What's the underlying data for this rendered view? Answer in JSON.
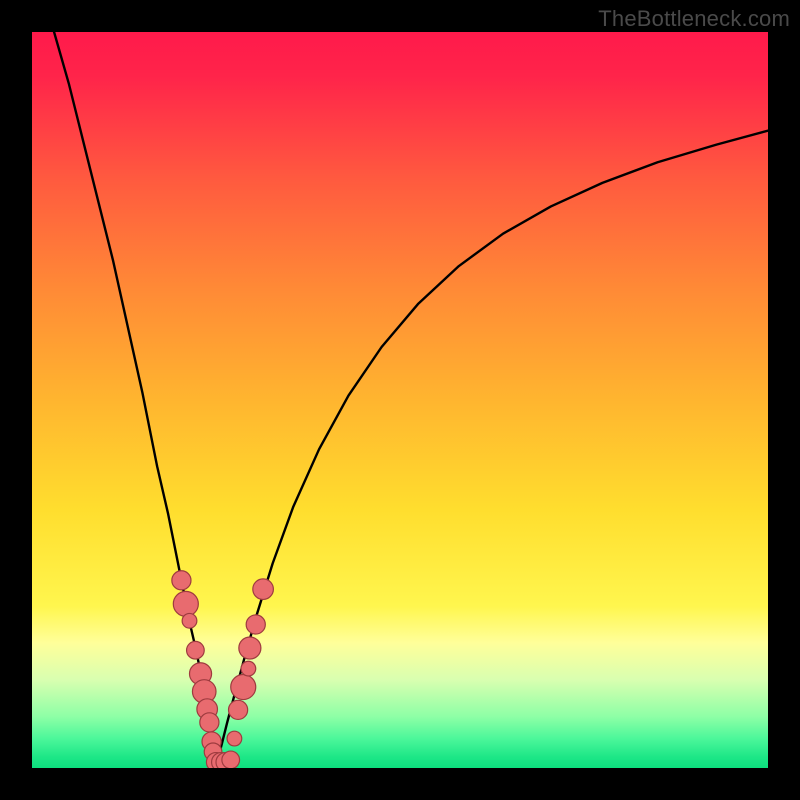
{
  "watermark": "TheBottleneck.com",
  "chart_data": {
    "type": "line",
    "title": "",
    "xlabel": "",
    "ylabel": "",
    "xlim": [
      0,
      100
    ],
    "ylim": [
      0,
      100
    ],
    "grid": false,
    "legend": false,
    "background_gradient": {
      "stops": [
        {
          "offset": 0.0,
          "color": "#ff1a4b"
        },
        {
          "offset": 0.06,
          "color": "#ff244a"
        },
        {
          "offset": 0.2,
          "color": "#ff5a3f"
        },
        {
          "offset": 0.35,
          "color": "#ff8a36"
        },
        {
          "offset": 0.5,
          "color": "#ffb52f"
        },
        {
          "offset": 0.65,
          "color": "#ffde2e"
        },
        {
          "offset": 0.78,
          "color": "#fff64e"
        },
        {
          "offset": 0.83,
          "color": "#ffff9a"
        },
        {
          "offset": 0.88,
          "color": "#d9ffb0"
        },
        {
          "offset": 0.93,
          "color": "#8effa6"
        },
        {
          "offset": 0.96,
          "color": "#4cf79a"
        },
        {
          "offset": 0.985,
          "color": "#1de787"
        },
        {
          "offset": 1.0,
          "color": "#0ddf7e"
        }
      ]
    },
    "series": [
      {
        "name": "left-curve",
        "type": "line",
        "color": "#000000",
        "x": [
          3,
          5,
          7,
          9,
          11,
          13,
          15,
          17,
          18.5,
          19.8,
          20.8,
          21.6,
          22.3,
          22.9,
          23.4,
          23.8,
          24.1,
          24.3,
          24.5,
          24.7,
          24.8,
          24.9,
          25
        ],
        "y": [
          100,
          93,
          85,
          77,
          69,
          60,
          51,
          41,
          34.5,
          28,
          23,
          19,
          16,
          13,
          10.5,
          8.3,
          6.4,
          4.8,
          3.4,
          2.2,
          1.3,
          0.6,
          0.1
        ]
      },
      {
        "name": "right-curve",
        "type": "line",
        "color": "#000000",
        "x": [
          25,
          25.3,
          25.8,
          26.5,
          27.5,
          28.8,
          30.5,
          32.7,
          35.5,
          39,
          43,
          47.5,
          52.5,
          58,
          64,
          70.5,
          77.5,
          85,
          93,
          100
        ],
        "y": [
          0.1,
          1.4,
          3.3,
          6.1,
          9.9,
          14.7,
          20.7,
          27.8,
          35.5,
          43.3,
          50.6,
          57.2,
          63.1,
          68.2,
          72.6,
          76.3,
          79.5,
          82.3,
          84.7,
          86.6
        ]
      },
      {
        "name": "markers",
        "type": "scatter",
        "color": "#e86b6f",
        "border": "#9e3b3f",
        "points": [
          {
            "x": 20.3,
            "y": 25.5,
            "r": 1.3
          },
          {
            "x": 20.9,
            "y": 22.3,
            "r": 1.7
          },
          {
            "x": 21.4,
            "y": 20.0,
            "r": 1.0
          },
          {
            "x": 22.2,
            "y": 16.0,
            "r": 1.2
          },
          {
            "x": 22.9,
            "y": 12.8,
            "r": 1.5
          },
          {
            "x": 23.4,
            "y": 10.4,
            "r": 1.6
          },
          {
            "x": 23.8,
            "y": 8.0,
            "r": 1.4
          },
          {
            "x": 24.1,
            "y": 6.2,
            "r": 1.3
          },
          {
            "x": 24.4,
            "y": 3.6,
            "r": 1.3
          },
          {
            "x": 24.6,
            "y": 2.2,
            "r": 1.2
          },
          {
            "x": 25.0,
            "y": 0.8,
            "r": 1.3
          },
          {
            "x": 25.7,
            "y": 0.8,
            "r": 1.3
          },
          {
            "x": 26.3,
            "y": 0.8,
            "r": 1.3
          },
          {
            "x": 27.0,
            "y": 1.1,
            "r": 1.2
          },
          {
            "x": 27.5,
            "y": 4.0,
            "r": 1.0
          },
          {
            "x": 28.0,
            "y": 7.9,
            "r": 1.3
          },
          {
            "x": 28.7,
            "y": 11.0,
            "r": 1.7
          },
          {
            "x": 29.4,
            "y": 13.5,
            "r": 1.0
          },
          {
            "x": 29.6,
            "y": 16.3,
            "r": 1.5
          },
          {
            "x": 30.4,
            "y": 19.5,
            "r": 1.3
          },
          {
            "x": 31.4,
            "y": 24.3,
            "r": 1.4
          }
        ]
      }
    ]
  }
}
